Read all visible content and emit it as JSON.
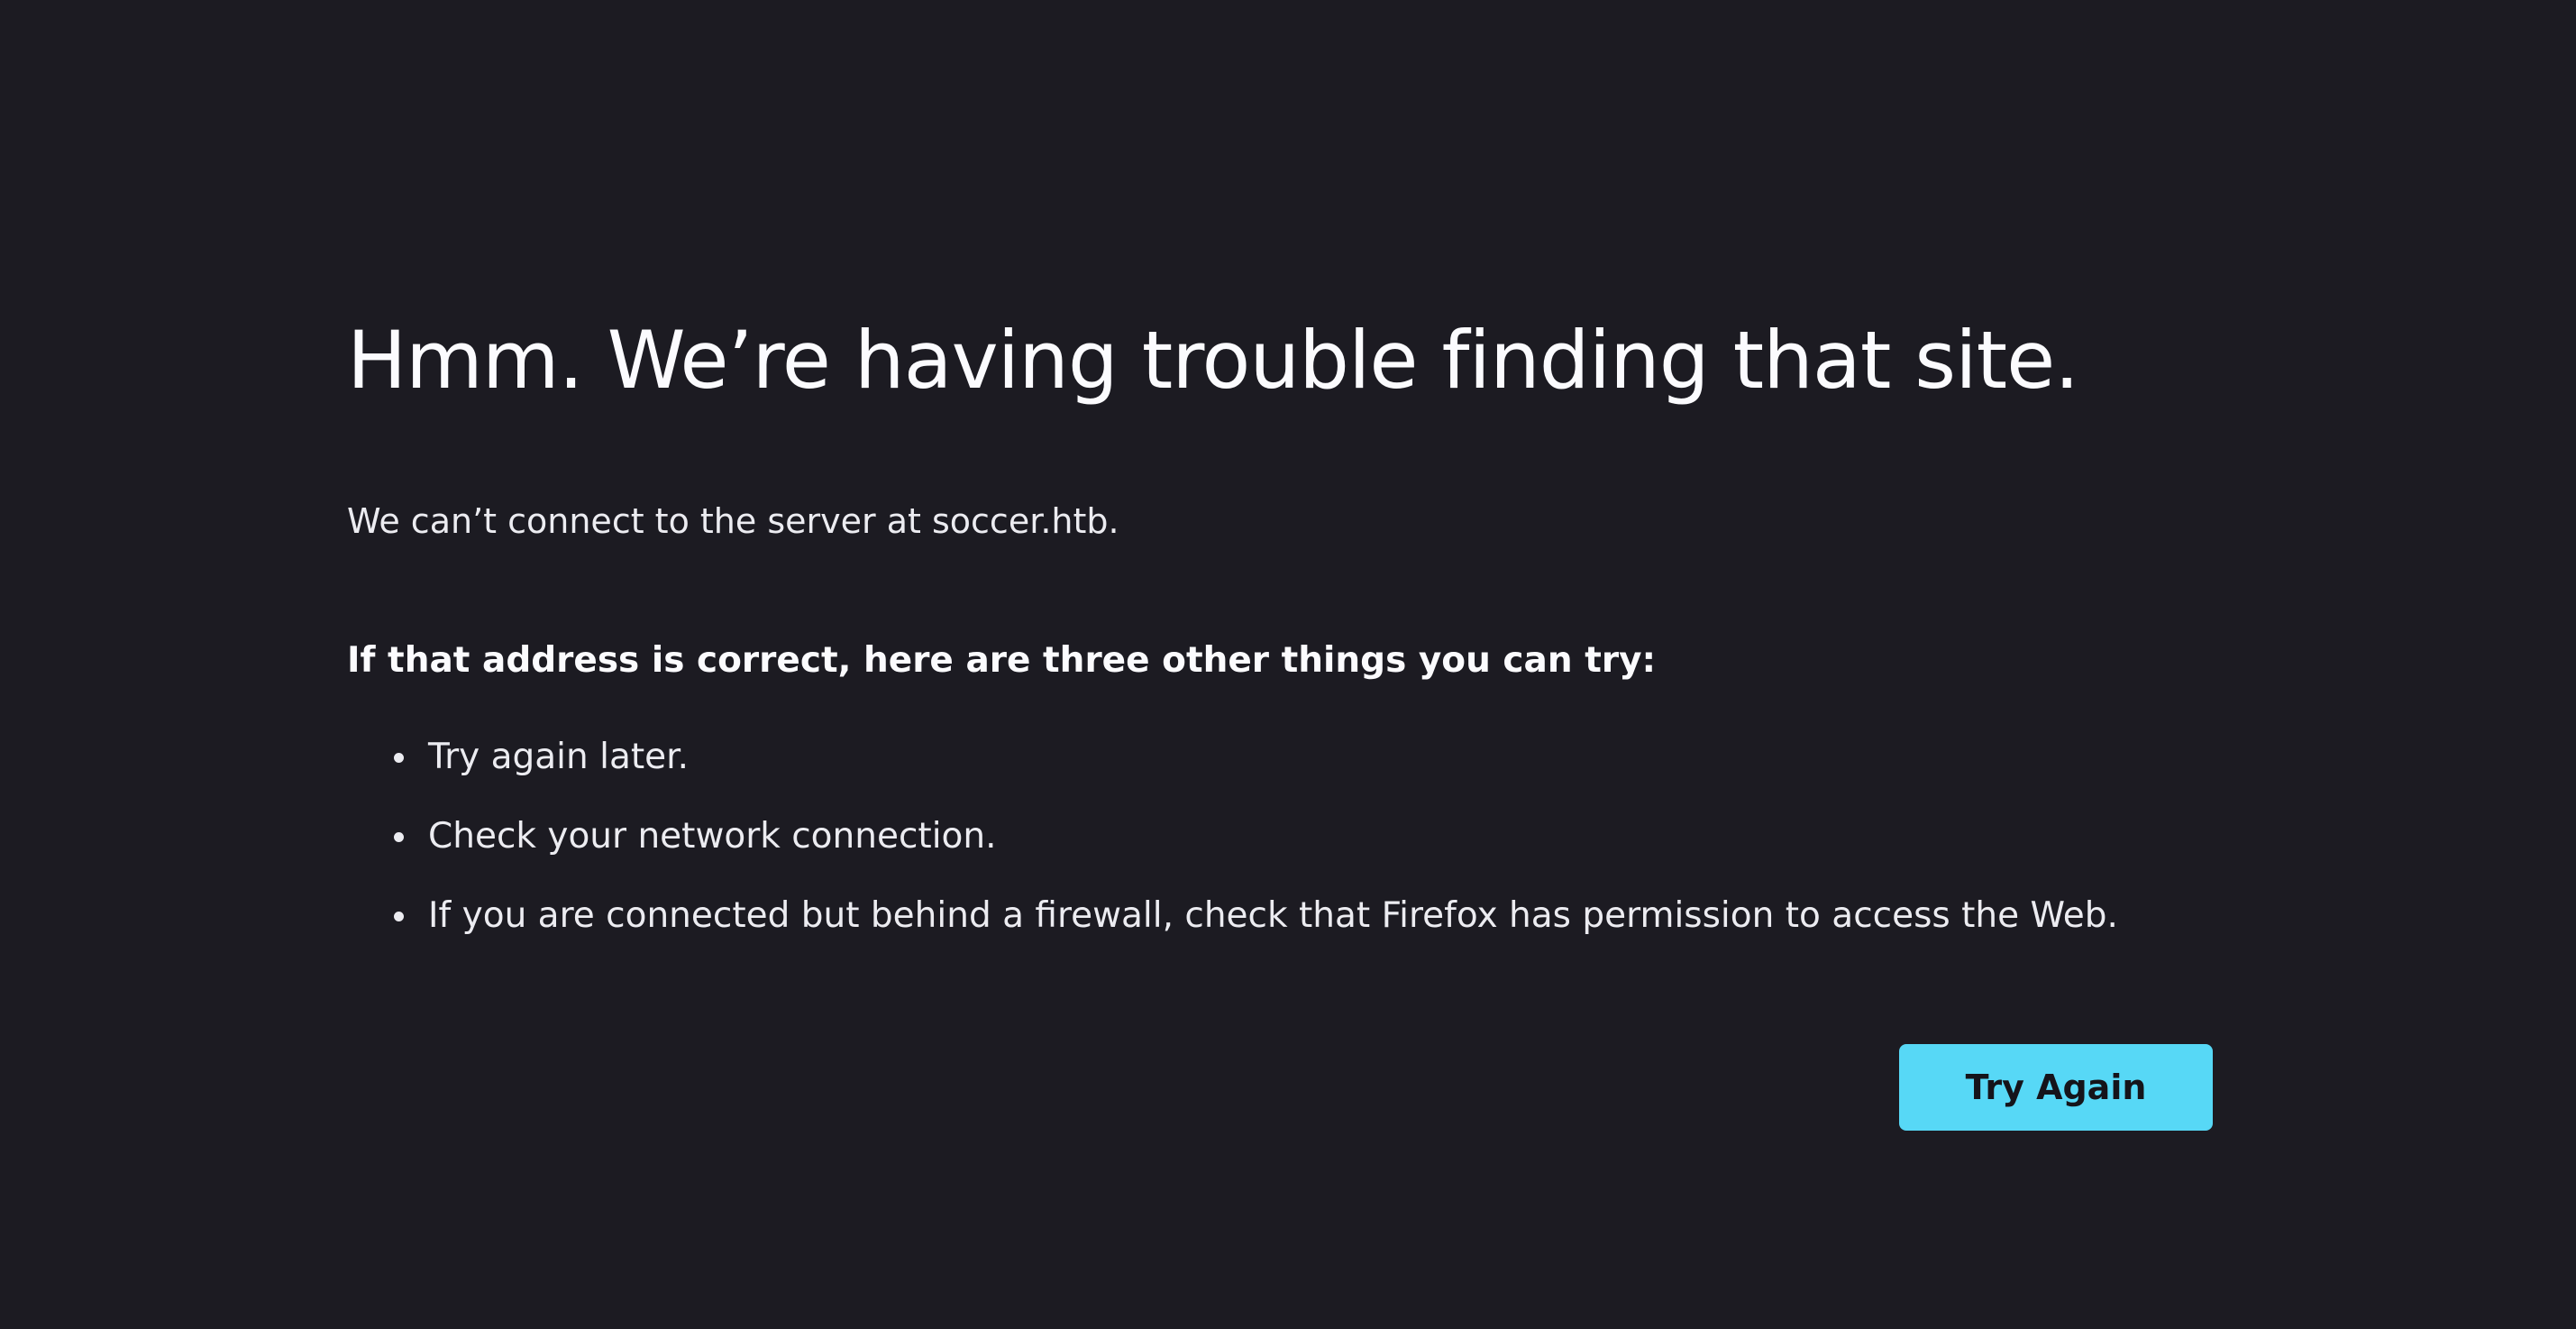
{
  "error_page": {
    "title": "Hmm. We’re having trouble finding that site.",
    "message": "We can’t connect to the server at soccer.htb.",
    "suggestion_heading": "If that address is correct, here are three other things you can try:",
    "suggestions": [
      "Try again later.",
      "Check your network connection.",
      "If you are connected but behind a firewall, check that Firefox has permission to access the Web."
    ],
    "try_again_label": "Try Again"
  },
  "colors": {
    "background": "#1c1b22",
    "text": "#fbfbfe",
    "button": "#57d8f6",
    "button_text": "#15141a"
  }
}
